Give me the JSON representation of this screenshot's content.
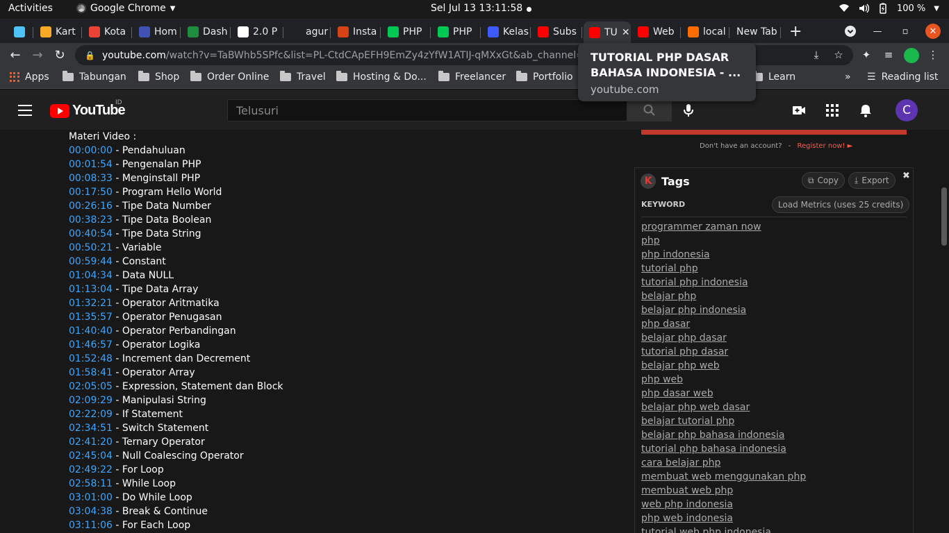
{
  "gnome": {
    "activities": "Activities",
    "app": "Google Chrome",
    "clock": "Sel Jul 13  13:11:58",
    "battery": "100 %"
  },
  "tabs": [
    {
      "label": "",
      "fav_color": "#4fc3f7"
    },
    {
      "label": "Kart",
      "fav_color": "#f9a825"
    },
    {
      "label": "Kota",
      "fav_color": "#ea4335"
    },
    {
      "label": "Hom",
      "fav_color": "#3f51b5"
    },
    {
      "label": "Dash",
      "fav_color": "#1e8e3e"
    },
    {
      "label": "2.0 P",
      "fav_color": "#ffffff"
    },
    {
      "label": "agur",
      "fav_color": "#202124"
    },
    {
      "label": "Insta",
      "fav_color": "#d84315"
    },
    {
      "label": "PHP",
      "fav_color": "#00c853"
    },
    {
      "label": "PHP",
      "fav_color": "#00c853"
    },
    {
      "label": "Kelas",
      "fav_color": "#3d5afe"
    },
    {
      "label": "Subs",
      "fav_color": "#ff0000"
    },
    {
      "label": "TU",
      "fav_color": "#ff0000"
    },
    {
      "label": "Web",
      "fav_color": "#ff0000"
    },
    {
      "label": "local",
      "fav_color": "#ff6d00"
    },
    {
      "label": "New Tab",
      "fav_color": ""
    }
  ],
  "omnibox": {
    "host": "youtube.com",
    "path": "/watch?v=TaBWhb5SPfc&list=PL-CtdCApEFH9EmZy4zYfW1ATIJ-qMXxGt&ab_channel=Programm"
  },
  "bookmarks": {
    "apps": "Apps",
    "folders": [
      "Tabungan",
      "Shop",
      "Order Online",
      "Travel",
      "Hosting & Do...",
      "Freelancer",
      "Portfolio",
      "Learn"
    ],
    "reading_list": "Reading list",
    "more": "»"
  },
  "hovercard": {
    "title": "TUTORIAL PHP DASAR BAHASA INDONESIA - ...",
    "url": "youtube.com"
  },
  "youtube": {
    "logo": "YouTube",
    "region": "ID",
    "search_placeholder": "Telusuri",
    "avatar_letter": "C"
  },
  "description": {
    "heading": "Materi Video :",
    "chapters": [
      {
        "time": "00:00:00",
        "title": " - Pendahuluan"
      },
      {
        "time": "00:01:54",
        "title": " - Pengenalan PHP"
      },
      {
        "time": "00:08:33",
        "title": " - Menginstall PHP"
      },
      {
        "time": "00:17:50",
        "title": " - Program Hello World"
      },
      {
        "time": "00:26:16",
        "title": " - Tipe Data Number"
      },
      {
        "time": "00:38:23",
        "title": " - Tipe Data Boolean"
      },
      {
        "time": "00:40:54",
        "title": " - Tipe Data String"
      },
      {
        "time": "00:50:21",
        "title": " - Variable"
      },
      {
        "time": "00:59:44",
        "title": " - Constant"
      },
      {
        "time": "01:04:34",
        "title": " - Data NULL"
      },
      {
        "time": "01:13:04",
        "title": " - Tipe Data Array"
      },
      {
        "time": "01:32:21",
        "title": " - Operator Aritmatika"
      },
      {
        "time": "01:35:57",
        "title": " - Operator Penugasan"
      },
      {
        "time": "01:40:40",
        "title": " - Operator Perbandingan"
      },
      {
        "time": "01:46:57",
        "title": " - Operator Logika"
      },
      {
        "time": "01:52:48",
        "title": " - Increment dan Decrement"
      },
      {
        "time": "01:58:41",
        "title": " - Operator Array"
      },
      {
        "time": "02:05:05",
        "title": " - Expression, Statement dan Block"
      },
      {
        "time": "02:09:29",
        "title": " - Manipulasi String"
      },
      {
        "time": "02:22:09",
        "title": " - If Statement"
      },
      {
        "time": "02:34:51",
        "title": " - Switch Statement"
      },
      {
        "time": "02:41:20",
        "title": " - Ternary Operator"
      },
      {
        "time": "02:45:04",
        "title": " - Null Coalescing Operator"
      },
      {
        "time": "02:49:22",
        "title": " - For Loop"
      },
      {
        "time": "02:58:11",
        "title": " - While Loop"
      },
      {
        "time": "03:01:00",
        "title": " - Do While Loop"
      },
      {
        "time": "03:04:38",
        "title": " - Break & Continue"
      },
      {
        "time": "03:11:06",
        "title": " - For Each Loop"
      }
    ]
  },
  "account": {
    "prompt": "Don't have an account?",
    "dash": "-",
    "register": "Register now! ►"
  },
  "tags_panel": {
    "title": "Tags",
    "copy": "Copy",
    "export": "Export",
    "close": "✖",
    "keyword_label": "KEYWORD",
    "load_metrics": "Load Metrics (uses 25 credits)",
    "keywords": [
      "programmer zaman now",
      "php",
      "php indonesia",
      "tutorial php",
      "tutorial php indonesia",
      "belajar php",
      "belajar php indonesia",
      "php dasar",
      "belajar php dasar",
      "tutorial php dasar",
      "belajar php web",
      "php web",
      "php dasar web",
      "belajar php web dasar",
      "belajar tutorial php",
      "belajar php bahasa indonesia",
      "tutorial php bahasa indonesia",
      "cara belajar php",
      "membuat web menggunakan php",
      "membuat web php",
      "web php indonesia",
      "php web indonesia",
      "tutorial web php indonesia"
    ]
  }
}
